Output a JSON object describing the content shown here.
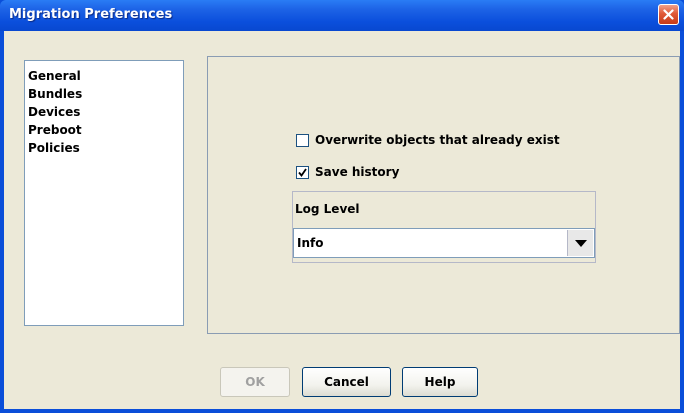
{
  "window": {
    "title": "Migration Preferences",
    "colors": {
      "titlebar": "#0b4fdc",
      "client": "#ece9d8",
      "close": "#e05a38"
    }
  },
  "sidebar": {
    "items": [
      {
        "label": "General"
      },
      {
        "label": "Bundles"
      },
      {
        "label": "Devices"
      },
      {
        "label": "Preboot"
      },
      {
        "label": "Policies"
      }
    ]
  },
  "options": {
    "overwrite": {
      "label": "Overwrite objects that already exist",
      "checked": false
    },
    "save_history": {
      "label": "Save history",
      "checked": true
    }
  },
  "log_level": {
    "label": "Log Level",
    "selected": "Info"
  },
  "buttons": {
    "ok": {
      "label": "OK",
      "enabled": false
    },
    "cancel": {
      "label": "Cancel",
      "enabled": true
    },
    "help": {
      "label": "Help",
      "enabled": true
    }
  },
  "icons": {
    "close": "close-x-icon",
    "checkmark": "checkmark-icon",
    "dropdown": "chevron-down-icon"
  }
}
